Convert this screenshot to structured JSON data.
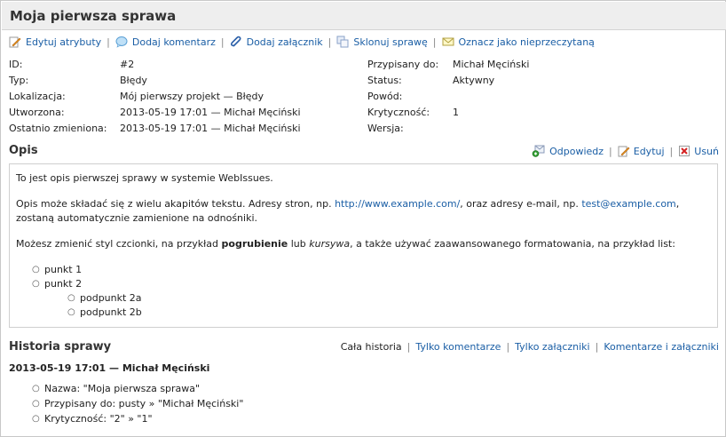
{
  "issue": {
    "title": "Moja pierwsza sprawa"
  },
  "toolbar": {
    "edit_attributes": "Edytuj atrybuty",
    "add_comment": "Dodaj komentarz",
    "add_attachment": "Dodaj załącznik",
    "clone": "Sklonuj sprawę",
    "mark_unread": "Oznacz jako nieprzeczytaną",
    "separator": "|"
  },
  "properties_left": [
    {
      "label": "ID:",
      "value": "#2"
    },
    {
      "label": "Typ:",
      "value": "Błędy"
    },
    {
      "label": "Lokalizacja:",
      "value": "Mój pierwszy projekt — Błędy"
    },
    {
      "label": "Utworzona:",
      "value": "2013-05-19 17:01 — Michał Męciński"
    },
    {
      "label": "Ostatnio zmieniona:",
      "value": "2013-05-19 17:01 — Michał Męciński"
    }
  ],
  "properties_right": [
    {
      "label": "Przypisany do:",
      "value": "Michał Męciński"
    },
    {
      "label": "Status:",
      "value": "Aktywny"
    },
    {
      "label": "Powód:",
      "value": ""
    },
    {
      "label": "Krytyczność:",
      "value": "1"
    },
    {
      "label": "Wersja:",
      "value": ""
    }
  ],
  "description": {
    "heading": "Opis",
    "reply": "Odpowiedz",
    "edit": "Edytuj",
    "delete": "Usuń",
    "para1": "To jest opis pierwszej sprawy w systemie WebIssues.",
    "para2_a": "Opis może składać się z wielu akapitów tekstu. Adresy stron, np. ",
    "para2_link1": "http://www.example.com/",
    "para2_b": ", oraz adresy e-mail, np. ",
    "para2_link2": "test@example.com",
    "para2_c": ",",
    "para2_d": "zostaną automatycznie zamienione na odnośniki.",
    "para3_a": "Możesz zmienić styl czcionki, na przykład ",
    "para3_bold": "pogrubienie",
    "para3_b": " lub ",
    "para3_italic": "kursywa",
    "para3_c": ", a także używać zaawansowanego formatowania, na przykład list:",
    "bullet": "○",
    "item1": "punkt 1",
    "item2": "punkt 2",
    "sub1": "podpunkt 2a",
    "sub2": "podpunkt 2b"
  },
  "history": {
    "heading": "Historia sprawy",
    "filter_all": "Cała historia",
    "filter_comments": "Tylko komentarze",
    "filter_attachments": "Tylko załączniki",
    "filter_both": "Komentarze i załączniki",
    "entry_header": "2013-05-19 17:01 — Michał Męciński",
    "changes": [
      "Nazwa: \"Moja pierwsza sprawa\"",
      "Przypisany do: pusty » \"Michał Męciński\"",
      "Krytyczność: \"2\" » \"1\""
    ]
  }
}
